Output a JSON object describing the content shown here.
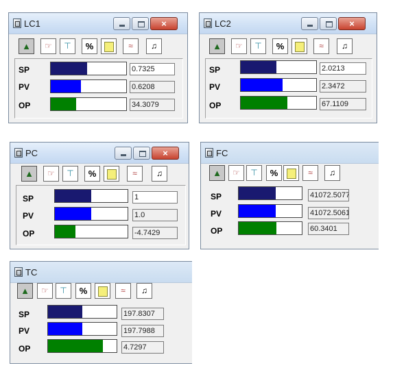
{
  "colors": {
    "sp_fill": "#191970",
    "pv_fill": "#0000ff",
    "op_fill": "#008000"
  },
  "toolbar_icons": [
    "car-icon",
    "hand-icon",
    "tap-icon",
    "percent-icon",
    "note-icon",
    "graph-icon",
    "music-icon"
  ],
  "labels": {
    "sp": "SP",
    "pv": "PV",
    "op": "OP"
  },
  "windows": [
    {
      "id": "LC1",
      "title": "LC1",
      "close_label": "×",
      "sp": {
        "value": "0.7325",
        "level": 0.48
      },
      "pv": {
        "value": "0.6208",
        "level": 0.4
      },
      "op": {
        "value": "34.3079",
        "level": 0.34
      }
    },
    {
      "id": "LC2",
      "title": "LC2",
      "close_label": "×",
      "sp": {
        "value": "2.0213",
        "level": 0.47
      },
      "pv": {
        "value": "2.3472",
        "level": 0.55
      },
      "op": {
        "value": "67.1109",
        "level": 0.62
      }
    },
    {
      "id": "PC",
      "title": "PC",
      "close_label": "×",
      "sp": {
        "value": "1",
        "level": 0.5
      },
      "pv": {
        "value": "1.0",
        "level": 0.5
      },
      "op": {
        "value": "-4.7429",
        "level": 0.28
      }
    },
    {
      "id": "FC",
      "title": "FC",
      "sp": {
        "value": "41072.5077",
        "level": 0.59
      },
      "pv": {
        "value": "41072.5061",
        "level": 0.59
      },
      "op": {
        "value": "60.3401",
        "level": 0.6
      }
    },
    {
      "id": "TC",
      "title": "TC",
      "sp": {
        "value": "197.8307",
        "level": 0.5
      },
      "pv": {
        "value": "197.7988",
        "level": 0.5
      },
      "op": {
        "value": "4.7297",
        "level": 0.8
      }
    }
  ]
}
